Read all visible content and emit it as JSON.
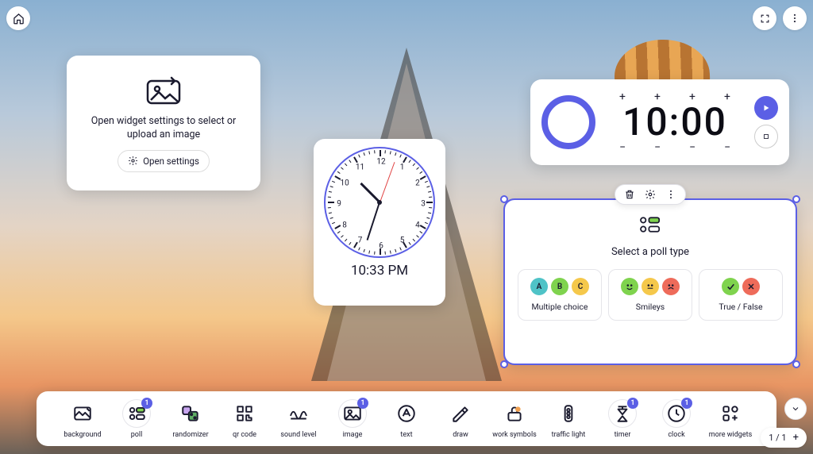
{
  "image_widget": {
    "message": "Open widget settings to select or upload an image",
    "button_label": "Open settings"
  },
  "clock": {
    "time_text": "10:33 PM",
    "numbers": [
      "12",
      "1",
      "2",
      "3",
      "4",
      "5",
      "6",
      "7",
      "8",
      "9",
      "10",
      "11"
    ]
  },
  "timer": {
    "display": "10:00",
    "plus": "+",
    "minus": "−"
  },
  "poll": {
    "title": "Select a poll type",
    "options": [
      {
        "label": "Multiple choice",
        "letters": [
          "A",
          "B",
          "C"
        ],
        "colors": [
          "#4FC3C7",
          "#7FD34E",
          "#F5C84B"
        ]
      },
      {
        "label": "Smileys",
        "faces": [
          "happy",
          "neutral",
          "sad"
        ],
        "colors": [
          "#7FD34E",
          "#F5C84B",
          "#EE6B5A"
        ]
      },
      {
        "label": "True / False",
        "marks": [
          "check",
          "cross"
        ],
        "colors": [
          "#7FD34E",
          "#EE6B5A"
        ]
      }
    ]
  },
  "toolbar": {
    "items": [
      {
        "key": "background",
        "label": "background",
        "badge": null
      },
      {
        "key": "poll",
        "label": "poll",
        "badge": "1"
      },
      {
        "key": "randomizer",
        "label": "randomizer",
        "badge": null
      },
      {
        "key": "qr-code",
        "label": "qr code",
        "badge": null
      },
      {
        "key": "sound-level",
        "label": "sound level",
        "badge": null
      },
      {
        "key": "image",
        "label": "image",
        "badge": "1"
      },
      {
        "key": "text",
        "label": "text",
        "badge": null
      },
      {
        "key": "draw",
        "label": "draw",
        "badge": null
      },
      {
        "key": "work-symbols",
        "label": "work symbols",
        "badge": null
      },
      {
        "key": "traffic-light",
        "label": "traffic light",
        "badge": null
      },
      {
        "key": "timer",
        "label": "timer",
        "badge": "1"
      },
      {
        "key": "clock",
        "label": "clock",
        "badge": "1"
      },
      {
        "key": "more-widgets",
        "label": "more widgets",
        "badge": null
      }
    ]
  },
  "page": {
    "current": "1",
    "total": "1",
    "add": "+"
  }
}
